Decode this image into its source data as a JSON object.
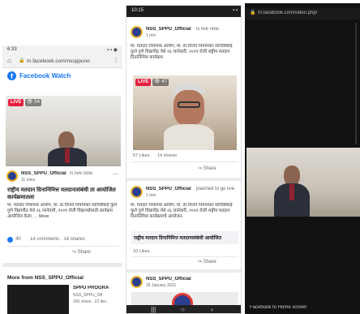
{
  "phone1": {
    "status_time": "6:33",
    "status_icons": "▪ ▪ ◉",
    "url": "m.facebook.com/nssppuno",
    "app_title": "Facebook Watch",
    "live_badge": "LIVE",
    "viewers": "54",
    "post_author": "NSS_SPPU_Official",
    "post_meta": "is live now.",
    "post_time": "11 mins",
    "post_title": "राष्ट्रीय मतदान दिनानिमित्त मतदानासंबंधी ता आयोजित कार्यक्रमातला",
    "post_body": "मा. मतदार नियामक आयोग, मा. डॉ.विजय नियामकर सावित्रीबाई फुले पुणे विद्यापीठ येथे २६ जानेवारी, २०२१ रोजी विद्यार्थ्यांसाठी कार्यक्रम आयोजित केला. ... More",
    "reactions": "40",
    "comments": "14 comments · 14 shares",
    "share": "Share",
    "more_from": "More from NSS_SPPU_Official",
    "related_title": "SPPU PROGRA",
    "related_meta": "NSS_SPPU_Off",
    "related_views": "160 views · 22 dec"
  },
  "phone2": {
    "status_time": "10:15",
    "status_icons": "▪ ▪",
    "post_author": "NSS_SPPU_Official",
    "post_meta": "is live now.",
    "post_time": "1 min",
    "post_body": "मा. मतदार नियामक आयोग, मा. डॉ.विजय नियामकर सावित्रीबाई फुले पुणे विद्यापीठ येथे २६ जानेवारी, २०२१ रोजी राष्ट्रीय मतदान दिनानिमित्त कार्यक्रम.",
    "live_badge": "LIVE",
    "viewers": "47",
    "likes": "57 Likes",
    "comments": "14 shares",
    "share": "Share",
    "post2_author": "NSS_SPPU_Official",
    "post2_meta": "planned to go live.",
    "post2_time": "1 min",
    "post2_body": "मा. मतदार नियामक आयोग, मा. डॉ.विजय नियामकर सावित्रीबाई फुले पुणे विद्यापीठ येथे २६ जानेवारी, २०२१ रोजी राष्ट्रीय मतदान दिनानिमित्त कार्यक्रमाचे आयोजन.",
    "post2_title": "राष्ट्रीय मतदान दिनानिमित्त मतदानासंबंधी आयोजित",
    "likes2": "10 Likes",
    "share2": "Share",
    "post3_author": "NSS_SPPU_Official",
    "post3_time": "26 January 2021"
  },
  "phone3": {
    "url": "m.facebook.com/video.php/",
    "footer": "Facebook to Home screen"
  },
  "colors": {
    "facebook_blue": "#1877f2",
    "live_red": "#e41e3f",
    "dark_screen": "#111111"
  }
}
